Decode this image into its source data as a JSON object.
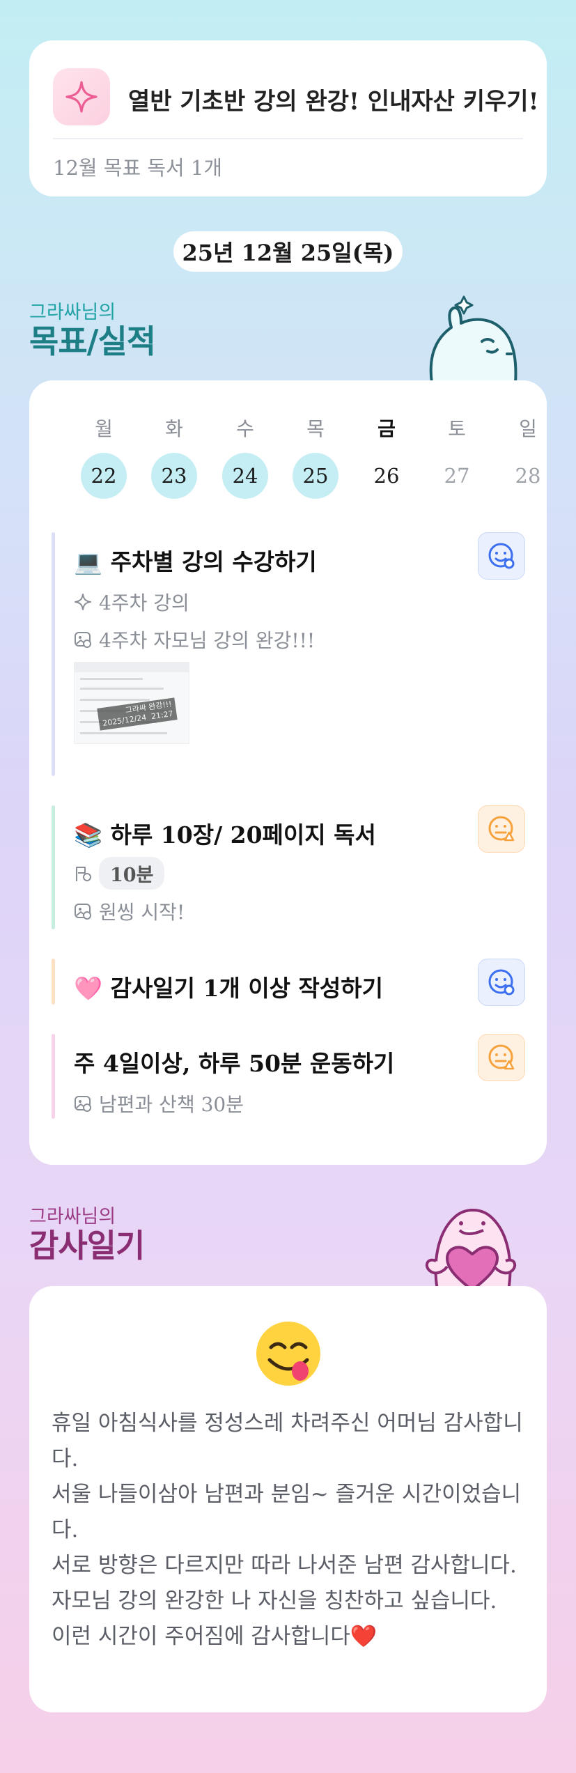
{
  "goal_card": {
    "title": "열반 기초반 강의 완강! 인내자산 키우기!",
    "subtitle": "12월 목표  독서 1개",
    "icon": "sparkle-icon"
  },
  "date": "25년 12월 25일(목)",
  "goals_section": {
    "owner": "그라싸님의",
    "title": "목표/실적"
  },
  "week": {
    "days": [
      {
        "label": "월",
        "date": "22",
        "state": "done"
      },
      {
        "label": "화",
        "date": "23",
        "state": "done"
      },
      {
        "label": "수",
        "date": "24",
        "state": "done"
      },
      {
        "label": "목",
        "date": "25",
        "state": "done"
      },
      {
        "label": "금",
        "date": "26",
        "state": "today"
      },
      {
        "label": "토",
        "date": "27",
        "state": "future"
      },
      {
        "label": "일",
        "date": "28",
        "state": "future"
      }
    ]
  },
  "tasks": [
    {
      "title": "💻 주차별 강의 수강하기",
      "detail": "4주차 강의",
      "note": "4주차 자모님 강의 완강!!!",
      "thumbnail_stamp": "그라싸 완강!!!\n2025/12/24  21:27",
      "status": "happy",
      "bar_color": "#dcdff6"
    },
    {
      "title": "📚 하루 10장/ 20페이지 독서",
      "duration": "10분",
      "note": "원씽 시작!",
      "status": "warn",
      "bar_color": "#c7eede"
    },
    {
      "title": "🩷 감사일기 1개 이상 작성하기",
      "status": "happy",
      "bar_color": "#fde0c4"
    },
    {
      "title": "주 4일이상, 하루 50분 운동하기",
      "note": "남편과 산책 30분",
      "status": "warn",
      "bar_color": "#f8d3ea"
    }
  ],
  "diary_section": {
    "owner": "그라싸님의",
    "title": "감사일기"
  },
  "diary": {
    "emoji": "😋",
    "lines": [
      "휴일 아침식사를 정성스레 차려주신 어머님 감사합니다.",
      "서울 나들이삼아 남편과 분임~ 즐거운 시간이었습니다.",
      "서로 방향은 다르지만 따라 나서준 남편 감사합니다.",
      "자모님 강의 완강한 나 자신을 칭찬하고 싶습니다.",
      "이런 시간이 주어짐에 감사합니다❤️"
    ]
  },
  "colors": {
    "teal_title": "#1d7f85",
    "plum_title": "#8a2d73",
    "done_day": "#c4eef4",
    "face_blue": "#3b6ff0",
    "face_orange": "#f5a23c"
  }
}
